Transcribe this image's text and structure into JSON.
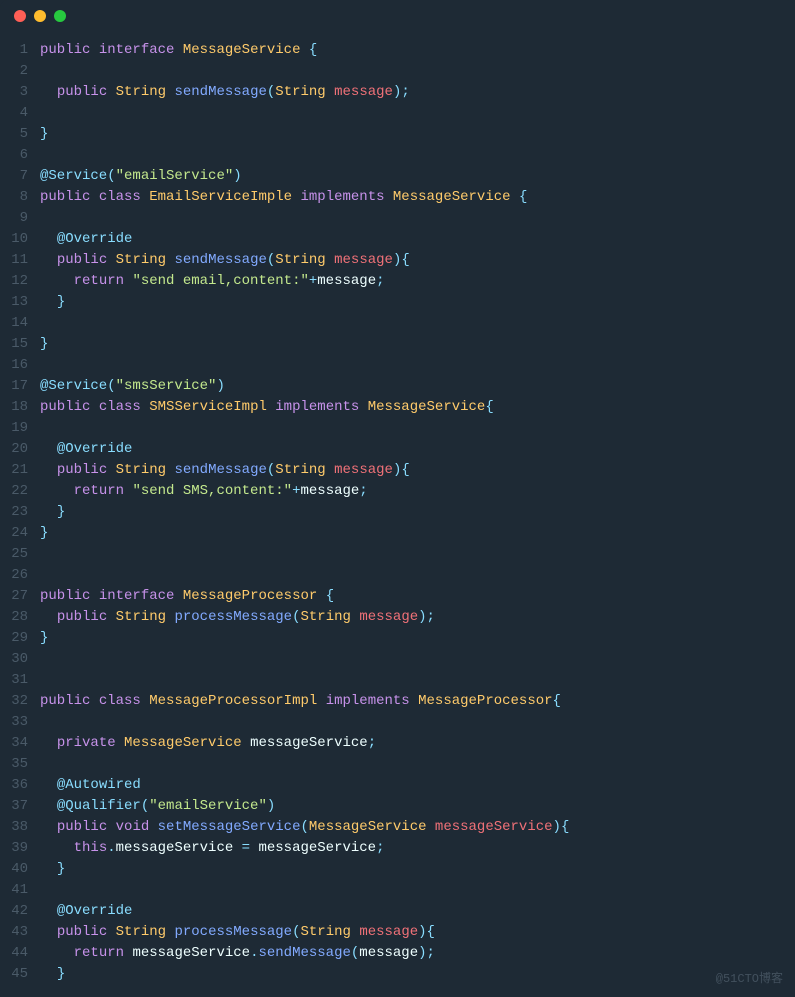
{
  "watermark": "@51CTO博客",
  "lines": [
    {
      "n": "1",
      "tokens": [
        [
          "pkw",
          "public"
        ],
        [
          "",
          ""
        ],
        [
          "pkw",
          "interface"
        ],
        [
          "",
          ""
        ],
        [
          "cls",
          "MessageService"
        ],
        [
          "",
          ""
        ],
        [
          "punc",
          "{"
        ]
      ]
    },
    {
      "n": "2",
      "tokens": []
    },
    {
      "n": "3",
      "tokens": [
        [
          "",
          "  "
        ],
        [
          "pkw",
          "public"
        ],
        [
          "",
          ""
        ],
        [
          "type",
          "String"
        ],
        [
          "",
          ""
        ],
        [
          "method",
          "sendMessage"
        ],
        [
          "punc",
          "("
        ],
        [
          "type",
          "String"
        ],
        [
          "",
          ""
        ],
        [
          "ident",
          "message"
        ],
        [
          "punc",
          ")"
        ],
        [
          "punc",
          ";"
        ]
      ]
    },
    {
      "n": "4",
      "tokens": []
    },
    {
      "n": "5",
      "tokens": [
        [
          "punc",
          "}"
        ]
      ]
    },
    {
      "n": "6",
      "tokens": []
    },
    {
      "n": "7",
      "tokens": [
        [
          "anno",
          "@Service"
        ],
        [
          "punc",
          "("
        ],
        [
          "str",
          "\"emailService\""
        ],
        [
          "punc",
          ")"
        ]
      ]
    },
    {
      "n": "8",
      "tokens": [
        [
          "pkw",
          "public"
        ],
        [
          "",
          ""
        ],
        [
          "pkw",
          "class"
        ],
        [
          "",
          ""
        ],
        [
          "cls",
          "EmailServiceImple"
        ],
        [
          "",
          ""
        ],
        [
          "pkw",
          "implements"
        ],
        [
          "",
          ""
        ],
        [
          "cls",
          "MessageService"
        ],
        [
          "",
          ""
        ],
        [
          "punc",
          "{"
        ]
      ]
    },
    {
      "n": "9",
      "tokens": []
    },
    {
      "n": "10",
      "tokens": [
        [
          "",
          "  "
        ],
        [
          "anno",
          "@Override"
        ]
      ]
    },
    {
      "n": "11",
      "tokens": [
        [
          "",
          "  "
        ],
        [
          "pkw",
          "public"
        ],
        [
          "",
          ""
        ],
        [
          "type",
          "String"
        ],
        [
          "",
          ""
        ],
        [
          "method",
          "sendMessage"
        ],
        [
          "punc",
          "("
        ],
        [
          "type",
          "String"
        ],
        [
          "",
          ""
        ],
        [
          "ident",
          "message"
        ],
        [
          "punc",
          ")"
        ],
        [
          "punc",
          "{"
        ]
      ]
    },
    {
      "n": "12",
      "tokens": [
        [
          "",
          "    "
        ],
        [
          "kw",
          "return"
        ],
        [
          "",
          ""
        ],
        [
          "str",
          "\"send email,content:\""
        ],
        [
          "punc",
          "+"
        ],
        [
          "var",
          "message"
        ],
        [
          "punc",
          ";"
        ]
      ]
    },
    {
      "n": "13",
      "tokens": [
        [
          "",
          "  "
        ],
        [
          "punc",
          "}"
        ]
      ]
    },
    {
      "n": "14",
      "tokens": []
    },
    {
      "n": "15",
      "tokens": [
        [
          "punc",
          "}"
        ]
      ]
    },
    {
      "n": "16",
      "tokens": []
    },
    {
      "n": "17",
      "tokens": [
        [
          "anno",
          "@Service"
        ],
        [
          "punc",
          "("
        ],
        [
          "str",
          "\"smsService\""
        ],
        [
          "punc",
          ")"
        ]
      ]
    },
    {
      "n": "18",
      "tokens": [
        [
          "pkw",
          "public"
        ],
        [
          "",
          ""
        ],
        [
          "pkw",
          "class"
        ],
        [
          "",
          ""
        ],
        [
          "cls",
          "SMSServiceImpl"
        ],
        [
          "",
          ""
        ],
        [
          "pkw",
          "implements"
        ],
        [
          "",
          ""
        ],
        [
          "cls",
          "MessageService"
        ],
        [
          "punc",
          "{"
        ]
      ]
    },
    {
      "n": "19",
      "tokens": []
    },
    {
      "n": "20",
      "tokens": [
        [
          "",
          "  "
        ],
        [
          "anno",
          "@Override"
        ]
      ]
    },
    {
      "n": "21",
      "tokens": [
        [
          "",
          "  "
        ],
        [
          "pkw",
          "public"
        ],
        [
          "",
          ""
        ],
        [
          "type",
          "String"
        ],
        [
          "",
          ""
        ],
        [
          "method",
          "sendMessage"
        ],
        [
          "punc",
          "("
        ],
        [
          "type",
          "String"
        ],
        [
          "",
          ""
        ],
        [
          "ident",
          "message"
        ],
        [
          "punc",
          ")"
        ],
        [
          "punc",
          "{"
        ]
      ]
    },
    {
      "n": "22",
      "tokens": [
        [
          "",
          "    "
        ],
        [
          "kw",
          "return"
        ],
        [
          "",
          ""
        ],
        [
          "str",
          "\"send SMS,content:\""
        ],
        [
          "punc",
          "+"
        ],
        [
          "var",
          "message"
        ],
        [
          "punc",
          ";"
        ]
      ]
    },
    {
      "n": "23",
      "tokens": [
        [
          "",
          "  "
        ],
        [
          "punc",
          "}"
        ]
      ]
    },
    {
      "n": "24",
      "tokens": [
        [
          "punc",
          "}"
        ]
      ]
    },
    {
      "n": "25",
      "tokens": []
    },
    {
      "n": "26",
      "tokens": []
    },
    {
      "n": "27",
      "tokens": [
        [
          "pkw",
          "public"
        ],
        [
          "",
          ""
        ],
        [
          "pkw",
          "interface"
        ],
        [
          "",
          ""
        ],
        [
          "cls",
          "MessageProcessor"
        ],
        [
          "",
          ""
        ],
        [
          "punc",
          "{"
        ]
      ]
    },
    {
      "n": "28",
      "tokens": [
        [
          "",
          "  "
        ],
        [
          "pkw",
          "public"
        ],
        [
          "",
          ""
        ],
        [
          "type",
          "String"
        ],
        [
          "",
          ""
        ],
        [
          "method",
          "processMessage"
        ],
        [
          "punc",
          "("
        ],
        [
          "type",
          "String"
        ],
        [
          "",
          ""
        ],
        [
          "ident",
          "message"
        ],
        [
          "punc",
          ")"
        ],
        [
          "punc",
          ";"
        ]
      ]
    },
    {
      "n": "29",
      "tokens": [
        [
          "punc",
          "}"
        ]
      ]
    },
    {
      "n": "30",
      "tokens": []
    },
    {
      "n": "31",
      "tokens": []
    },
    {
      "n": "32",
      "tokens": [
        [
          "pkw",
          "public"
        ],
        [
          "",
          ""
        ],
        [
          "pkw",
          "class"
        ],
        [
          "",
          ""
        ],
        [
          "cls",
          "MessageProcessorImpl"
        ],
        [
          "",
          ""
        ],
        [
          "pkw",
          "implements"
        ],
        [
          "",
          ""
        ],
        [
          "cls",
          "MessageProcessor"
        ],
        [
          "punc",
          "{"
        ]
      ]
    },
    {
      "n": "33",
      "tokens": []
    },
    {
      "n": "34",
      "tokens": [
        [
          "",
          "  "
        ],
        [
          "pkw",
          "private"
        ],
        [
          "",
          ""
        ],
        [
          "cls",
          "MessageService"
        ],
        [
          "",
          ""
        ],
        [
          "var",
          "messageService"
        ],
        [
          "punc",
          ";"
        ]
      ]
    },
    {
      "n": "35",
      "tokens": []
    },
    {
      "n": "36",
      "tokens": [
        [
          "",
          "  "
        ],
        [
          "anno",
          "@Autowired"
        ]
      ]
    },
    {
      "n": "37",
      "tokens": [
        [
          "",
          "  "
        ],
        [
          "anno",
          "@Qualifier"
        ],
        [
          "punc",
          "("
        ],
        [
          "str",
          "\"emailService\""
        ],
        [
          "punc",
          ")"
        ]
      ]
    },
    {
      "n": "38",
      "tokens": [
        [
          "",
          "  "
        ],
        [
          "pkw",
          "public"
        ],
        [
          "",
          ""
        ],
        [
          "kw",
          "void"
        ],
        [
          "",
          ""
        ],
        [
          "method",
          "setMessageService"
        ],
        [
          "punc",
          "("
        ],
        [
          "cls",
          "MessageService"
        ],
        [
          "",
          ""
        ],
        [
          "ident",
          "messageService"
        ],
        [
          "punc",
          ")"
        ],
        [
          "punc",
          "{"
        ]
      ]
    },
    {
      "n": "39",
      "tokens": [
        [
          "",
          "    "
        ],
        [
          "kw",
          "this"
        ],
        [
          "punc",
          "."
        ],
        [
          "var",
          "messageService"
        ],
        [
          "",
          ""
        ],
        [
          "punc",
          "="
        ],
        [
          "",
          ""
        ],
        [
          "var",
          "messageService"
        ],
        [
          "punc",
          ";"
        ]
      ]
    },
    {
      "n": "40",
      "tokens": [
        [
          "",
          "  "
        ],
        [
          "punc",
          "}"
        ]
      ]
    },
    {
      "n": "41",
      "tokens": []
    },
    {
      "n": "42",
      "tokens": [
        [
          "",
          "  "
        ],
        [
          "anno",
          "@Override"
        ]
      ]
    },
    {
      "n": "43",
      "tokens": [
        [
          "",
          "  "
        ],
        [
          "pkw",
          "public"
        ],
        [
          "",
          ""
        ],
        [
          "type",
          "String"
        ],
        [
          "",
          ""
        ],
        [
          "method",
          "processMessage"
        ],
        [
          "punc",
          "("
        ],
        [
          "type",
          "String"
        ],
        [
          "",
          ""
        ],
        [
          "ident",
          "message"
        ],
        [
          "punc",
          ")"
        ],
        [
          "punc",
          "{"
        ]
      ]
    },
    {
      "n": "44",
      "tokens": [
        [
          "",
          "    "
        ],
        [
          "kw",
          "return"
        ],
        [
          "",
          ""
        ],
        [
          "var",
          "messageService"
        ],
        [
          "punc",
          "."
        ],
        [
          "method",
          "sendMessage"
        ],
        [
          "punc",
          "("
        ],
        [
          "var",
          "message"
        ],
        [
          "punc",
          ")"
        ],
        [
          "punc",
          ";"
        ]
      ]
    },
    {
      "n": "45",
      "tokens": [
        [
          "",
          "  "
        ],
        [
          "punc",
          "}"
        ]
      ]
    }
  ]
}
